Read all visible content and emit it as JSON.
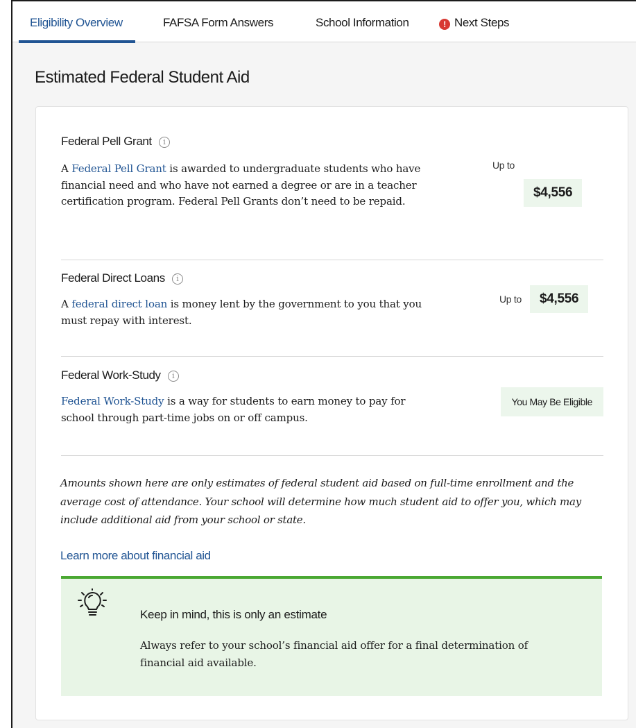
{
  "tabs": [
    {
      "label": "Eligibility Overview",
      "active": true
    },
    {
      "label": "FAFSA Form Answers"
    },
    {
      "label": "School Information"
    },
    {
      "label": "Next Steps",
      "icon": "alert-icon",
      "icon_glyph": "!"
    }
  ],
  "page_title": "Estimated Federal Student Aid",
  "aid": {
    "pell": {
      "title": "Federal Pell Grant",
      "info_glyph": "i",
      "link_text": "Federal Pell Grant",
      "desc_prefix": "A ",
      "desc_rest": " is awarded to undergraduate students who have financial need and who have not earned a degree or are in a teacher certification program. Federal Pell Grants don’t need to be repaid.",
      "upto_label": "Up to",
      "amount": "$4,556"
    },
    "loans": {
      "title": "Federal Direct Loans",
      "info_glyph": "i",
      "link_text": "federal direct loan",
      "desc_prefix": "A ",
      "desc_rest": " is money lent by the government to you that you must repay with interest.",
      "upto_label": "Up to",
      "amount": "$4,556"
    },
    "workstudy": {
      "title": "Federal Work-Study",
      "info_glyph": "i",
      "link_text": "Federal Work-Study",
      "desc_rest": " is a way for students to earn money to pay for school through part-time jobs on or off campus.",
      "status": "You May Be Eligible"
    }
  },
  "disclaimer": "Amounts shown here are only estimates of federal student aid based on full-time enrollment and the average cost of attendance. Your school will determine how much student aid to offer you, which may include additional aid from your school or state.",
  "learn_more": "Learn more about financial aid",
  "callout": {
    "icon": "lightbulb-icon",
    "title": "Keep in mind, this is only an estimate",
    "body": "Always refer to your school’s financial aid offer for a final determination of financial aid available."
  },
  "colors": {
    "accent": "#205493",
    "alert": "#d83933",
    "amount_bg": "#ecf6ec",
    "callout_bg": "#e8f5e6",
    "callout_border": "#4aa832"
  }
}
